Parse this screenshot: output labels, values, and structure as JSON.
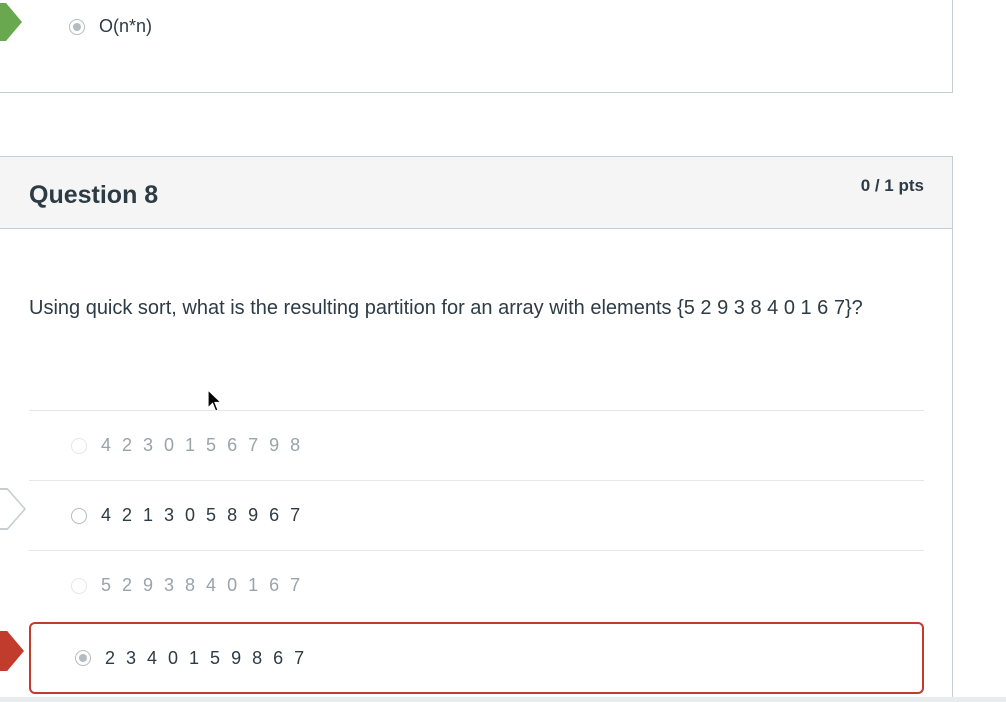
{
  "previous_question": {
    "selected_answer": "O(n*n)"
  },
  "question": {
    "title": "Question 8",
    "points": "0 / 1 pts",
    "text": "Using quick sort, what is the resulting partition for an array with elements {5 2 9 3 8 4 0 1 6 7}?",
    "answers": [
      {
        "label": "4 2 3 0 1 5 6 7 9 8",
        "state": "unselected"
      },
      {
        "label": "4 2 1 3 0 5 8 9 6 7",
        "state": "correct-answer"
      },
      {
        "label": "5 2 9 3 8 4 0 1 6 7",
        "state": "unselected"
      },
      {
        "label": "2 3 4 0 1 5 9 8 6 7",
        "state": "selected-wrong"
      }
    ]
  },
  "colors": {
    "correct_marker": "#6aa84f",
    "wrong_marker": "#c23c2d",
    "header_bg": "#f5f5f5",
    "border": "#c7cdd1",
    "text": "#2d3b45"
  }
}
